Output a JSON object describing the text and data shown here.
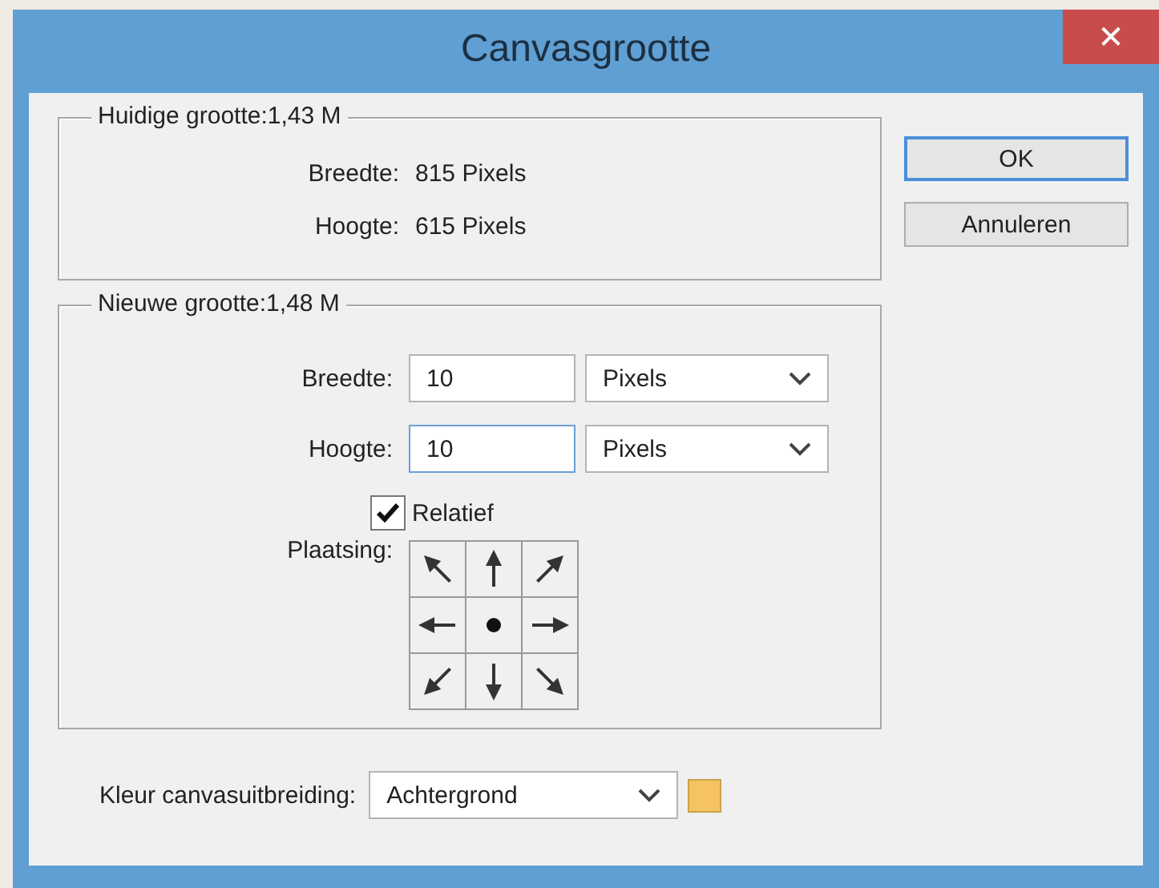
{
  "window": {
    "title": "Canvasgrootte",
    "close": "✕"
  },
  "current_size": {
    "legend": "Huidige grootte:1,43 M",
    "rows": [
      {
        "label": "Breedte:",
        "value": "815 Pixels"
      },
      {
        "label": "Hoogte:",
        "value": "615 Pixels"
      }
    ]
  },
  "new_size": {
    "legend": "Nieuwe grootte:1,48 M",
    "fields": [
      {
        "label": "Breedte:",
        "value": "10",
        "unit": "Pixels",
        "focused": false
      },
      {
        "label": "Hoogte:",
        "value": "10",
        "unit": "Pixels",
        "focused": true
      }
    ],
    "relative": {
      "label": "Relatief",
      "checked": true
    },
    "anchor": {
      "label": "Plaatsing:",
      "cells": [
        {
          "selected": false
        },
        {
          "selected": false
        },
        {
          "selected": false
        },
        {
          "selected": false
        },
        {
          "selected": true
        },
        {
          "selected": false
        },
        {
          "selected": false
        },
        {
          "selected": false
        },
        {
          "selected": false
        }
      ]
    }
  },
  "extension_color": {
    "label": "Kleur canvasuitbreiding:",
    "value": "Achtergrond",
    "color": "#f5c460"
  },
  "buttons": [
    "OK",
    "Annuleren"
  ]
}
